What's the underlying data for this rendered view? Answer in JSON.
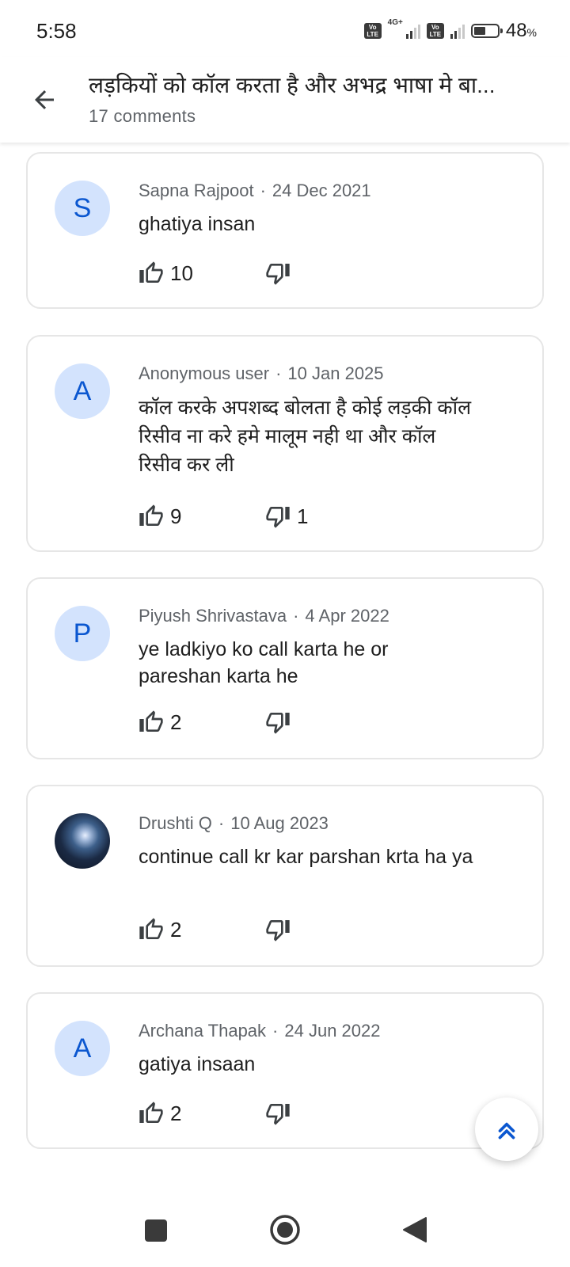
{
  "status_bar": {
    "time": "5:58",
    "network": "4G+",
    "volte": "Vo LTE",
    "battery_percent": "48",
    "battery_unit": "%",
    "battery_level": 0.48
  },
  "header": {
    "title": "लड़कियों को कॉल करता है और अभद्र भाषा मे बा...",
    "subtitle": "17 comments"
  },
  "comments": [
    {
      "avatar_letter": "S",
      "author": "Sapna Rajpoot",
      "separator": "·",
      "date": "24 Dec 2021",
      "text": "ghatiya insan",
      "likes": "10",
      "dislikes": ""
    },
    {
      "avatar_letter": "A",
      "author": "Anonymous user",
      "separator": "·",
      "date": "10 Jan 2025",
      "text": "कॉल करके अपशब्द बोलता है कोई लड़की कॉल रिसीव ना करे हमे मालूम नही था और कॉल रिसीव कर ली",
      "likes": "9",
      "dislikes": "1"
    },
    {
      "avatar_letter": "P",
      "author": "Piyush Shrivastava",
      "separator": "·",
      "date": "4 Apr 2022",
      "text": "ye ladkiyo ko call karta he or pareshan karta he",
      "likes": "2",
      "dislikes": ""
    },
    {
      "avatar_letter": "",
      "author": "Drushti Q",
      "separator": "·",
      "date": "10 Aug 2023",
      "text": "continue call kr kar parshan krta ha ya",
      "likes": "2",
      "dislikes": ""
    },
    {
      "avatar_letter": "A",
      "author": "Archana Thapak",
      "separator": "·",
      "date": "24 Jun 2022",
      "text": "gatiya insaan",
      "likes": "2",
      "dislikes": ""
    }
  ],
  "icons": {
    "back": "arrow-left-icon",
    "like": "thumbs-up-icon",
    "dislike": "thumbs-down-icon",
    "scroll_top": "double-chevron-up-icon",
    "nav_recents": "square-icon",
    "nav_home": "circle-icon",
    "nav_back": "triangle-back-icon"
  },
  "colors": {
    "accent": "#0b57d0",
    "avatar_bg": "#d3e3fd",
    "secondary_text": "#5f6368",
    "card_border": "#e6e6e6"
  }
}
